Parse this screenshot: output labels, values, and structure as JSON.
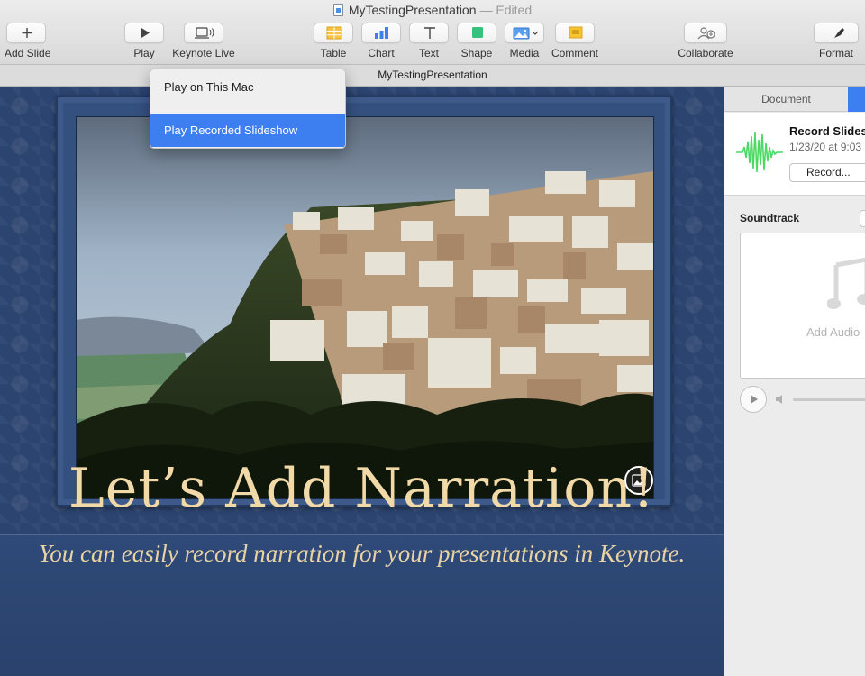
{
  "window": {
    "title": "MyTestingPresentation",
    "status": "— Edited"
  },
  "toolbar": {
    "add_slide": "Add Slide",
    "play": "Play",
    "keynote_live": "Keynote Live",
    "table": "Table",
    "chart": "Chart",
    "text": "Text",
    "shape": "Shape",
    "media": "Media",
    "comment": "Comment",
    "collaborate": "Collaborate",
    "format": "Format"
  },
  "document_tab": "MyTestingPresentation",
  "play_menu": {
    "items": [
      "Play on This Mac",
      "Play Recorded Slideshow"
    ],
    "selected": "Play Recorded Slideshow"
  },
  "slide": {
    "title": "Let’s Add Narration!",
    "subtitle": "You can easily record narration for your presentations in Keynote."
  },
  "inspector": {
    "tabs": {
      "document": "Document"
    },
    "record": {
      "title": "Record Slides",
      "date": "1/23/20 at 9:03",
      "button": "Record..."
    },
    "soundtrack_label": "Soundtrack",
    "add_audio_label": "Add Audio"
  },
  "icons": {
    "add_slide": "plus-icon",
    "play": "play-icon",
    "keynote_live": "keynote-live-icon",
    "table": "table-icon",
    "chart": "bar-chart-icon",
    "text": "text-icon",
    "shape": "shape-icon",
    "media": "media-icon",
    "comment": "comment-icon",
    "collaborate": "collaborate-icon",
    "format": "format-brush-icon"
  },
  "colors": {
    "accent": "#3d7ff0",
    "slide_background": "#2c4470",
    "slide_title": "#f1d9a8",
    "waveform": "#4cd964"
  }
}
